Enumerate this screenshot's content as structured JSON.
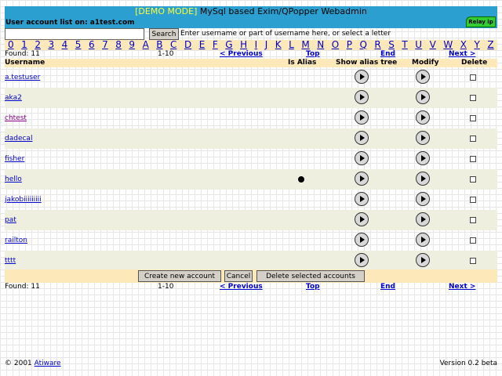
{
  "header": {
    "demo": "[DEMO MODE]",
    "title": "MySql based Exim/QPopper Webadmin",
    "userlist": "User account list on: a1test.com",
    "relay": "Relay ip"
  },
  "search": {
    "placeholder": "",
    "value": "",
    "button": "Search",
    "hint": "Enter username or part of username here, or select a letter"
  },
  "letters": [
    "0",
    "1",
    "2",
    "3",
    "4",
    "5",
    "6",
    "7",
    "8",
    "9",
    "A",
    "B",
    "C",
    "D",
    "E",
    "F",
    "G",
    "H",
    "I",
    "J",
    "K",
    "L",
    "M",
    "N",
    "O",
    "P",
    "Q",
    "R",
    "S",
    "T",
    "U",
    "V",
    "W",
    "X",
    "Y",
    "Z"
  ],
  "nav": {
    "found": "Found:  11",
    "range": "1-10",
    "previous": "< Previous",
    "top": "Top",
    "end": "End",
    "next": "Next >"
  },
  "columns": {
    "username": "Username",
    "is_alias": "Is Alias",
    "show_alias_tree": "Show alias tree",
    "modify": "Modify",
    "delete": "Delete"
  },
  "users": [
    {
      "name": "a.testuser",
      "alias": false,
      "visited": false
    },
    {
      "name": "aka2",
      "alias": false,
      "visited": false
    },
    {
      "name": "chtest",
      "alias": false,
      "visited": true
    },
    {
      "name": "dadecal",
      "alias": false,
      "visited": false
    },
    {
      "name": "fisher",
      "alias": false,
      "visited": false
    },
    {
      "name": "hello",
      "alias": true,
      "visited": false
    },
    {
      "name": "jakobiiiiiiiii",
      "alias": false,
      "visited": false
    },
    {
      "name": "pat",
      "alias": false,
      "visited": false
    },
    {
      "name": "railton",
      "alias": false,
      "visited": false
    },
    {
      "name": "tttt",
      "alias": false,
      "visited": false
    }
  ],
  "actions": {
    "create": "Create new account",
    "cancel": "Cancel",
    "delete": "Delete selected accounts"
  },
  "footer": {
    "copyright": "© 2001",
    "company": "Atiware",
    "version": "Version 0.2 beta"
  },
  "colors": {
    "header_bg": "#2b9fd0",
    "band_bg": "#fce8b8",
    "link": "#0000cc",
    "relay_bg": "#33cc33"
  }
}
